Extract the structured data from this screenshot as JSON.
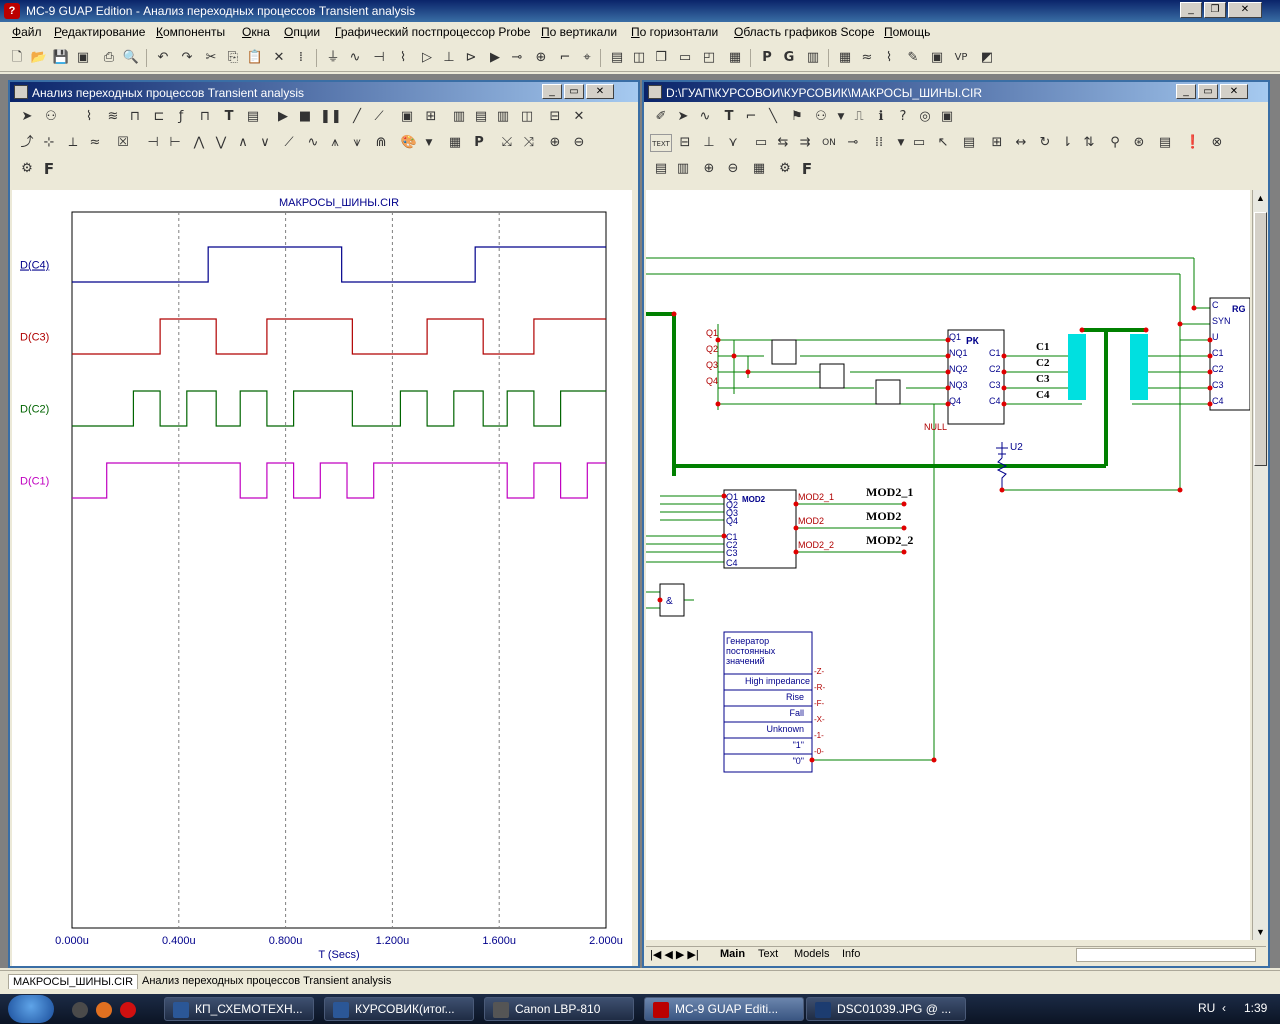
{
  "app": {
    "title": "MC-9 GUAP Edition - Анализ переходных процессов Transient analysis",
    "icon": "mc9-app-icon"
  },
  "menu": [
    "Файл",
    "Редактирование",
    "Компоненты",
    "Окна",
    "Опции",
    "Графический постпроцессор Probe",
    "По вертикали",
    "По горизонтали",
    "Область графиков Scope",
    "Помощь"
  ],
  "plot_window": {
    "title": "Анализ переходных процессов Transient analysis",
    "toolbar_letter": "F"
  },
  "schematic_window": {
    "title": "D:\\ГУАП\\КУРСОВОИ\\КУРСОВИК\\МАКРОСЫ_ШИНЫ.CIR",
    "toolbar_letter": "F",
    "text_button": "TEXT",
    "tabs": [
      "Main",
      "Text",
      "Models",
      "Info"
    ],
    "blocks": {
      "rk_label": "РК",
      "rg_label": "RG",
      "mod_label": "MOD2",
      "and_label": "&",
      "null_label": "NULL",
      "u2_label": "U2",
      "rk_inputs": [
        "Q1",
        "NQ1",
        "NQ2",
        "NQ3",
        "Q4"
      ],
      "rk_outputs": [
        "C1",
        "C2",
        "C3",
        "C4"
      ],
      "rg_pins": [
        "C",
        "SYN",
        "U",
        "C1",
        "C2",
        "C3",
        "C4"
      ],
      "left_q": [
        "Q1",
        "Q2",
        "Q3",
        "Q4"
      ],
      "bus_labels": [
        "C1",
        "C2",
        "C3",
        "C4"
      ],
      "mod_inputs": [
        "Q1",
        "Q2",
        "Q3",
        "Q4",
        "C1",
        "C2",
        "C3",
        "C4"
      ],
      "mod_outputs": [
        "MOD2_1",
        "MOD2",
        "MOD2_2"
      ],
      "mod_net_labels": [
        "MOD2_1",
        "MOD2",
        "MOD2_2"
      ],
      "gen_title": "Генератор постоянных значений",
      "gen_rows": [
        "High impedance",
        "Rise",
        "Fall",
        "Unknown",
        "\"1\"",
        "\"0\""
      ],
      "gen_pins": [
        "-Z-",
        "-R-",
        "-F-",
        "-X-",
        "-1-",
        "-0-"
      ]
    }
  },
  "chart_data": {
    "type": "line",
    "title": "МАКРОСЫ_ШИНЫ.CIR",
    "xlabel": "T (Secs)",
    "xlim": [
      0,
      2.0
    ],
    "x_ticks": [
      "0.000u",
      "0.400u",
      "0.800u",
      "1.200u",
      "1.600u",
      "2.000u"
    ],
    "grid": true,
    "series": [
      {
        "name": "D(C4)",
        "color": "#00008b",
        "transitions": [
          [
            0,
            0
          ],
          [
            0.51,
            1
          ],
          [
            1.01,
            0
          ],
          [
            1.51,
            1
          ],
          [
            2.0,
            1
          ]
        ]
      },
      {
        "name": "D(C3)",
        "color": "#b00000",
        "transitions": [
          [
            0,
            0
          ],
          [
            0.33,
            1
          ],
          [
            0.54,
            0
          ],
          [
            0.73,
            1
          ],
          [
            1.05,
            0
          ],
          [
            1.33,
            1
          ],
          [
            1.54,
            0
          ],
          [
            1.73,
            1
          ],
          [
            2.0,
            1
          ]
        ]
      },
      {
        "name": "D(C2)",
        "color": "#006400",
        "transitions": [
          [
            0,
            0
          ],
          [
            0.23,
            1
          ],
          [
            0.33,
            0
          ],
          [
            0.43,
            1
          ],
          [
            0.54,
            0
          ],
          [
            0.63,
            1
          ],
          [
            0.73,
            0
          ],
          [
            0.83,
            1
          ],
          [
            1.05,
            0
          ],
          [
            1.23,
            1
          ],
          [
            1.33,
            0
          ],
          [
            1.43,
            1
          ],
          [
            1.54,
            0
          ],
          [
            1.63,
            1
          ],
          [
            1.73,
            0
          ],
          [
            1.83,
            1
          ],
          [
            2.0,
            1
          ]
        ]
      },
      {
        "name": "D(C1)",
        "color": "#c000c0",
        "transitions": [
          [
            0,
            0
          ],
          [
            0.13,
            1
          ],
          [
            0.63,
            0
          ],
          [
            0.73,
            1
          ],
          [
            0.83,
            0
          ],
          [
            0.93,
            1
          ],
          [
            1.03,
            0
          ],
          [
            1.13,
            1
          ],
          [
            1.63,
            0
          ],
          [
            1.73,
            1
          ],
          [
            1.83,
            0
          ],
          [
            1.93,
            1
          ],
          [
            2.0,
            1
          ]
        ]
      }
    ]
  },
  "bottom_tabs": [
    "МАКРОСЫ_ШИНЫ.CIR",
    "Анализ переходных процессов Transient analysis"
  ],
  "taskbar": {
    "items": [
      {
        "label": "КП_СХЕМОТЕХН...",
        "icon": "word-icon"
      },
      {
        "label": "КУРСОВИК(итог...",
        "icon": "word-icon"
      },
      {
        "label": "Canon LBP-810",
        "icon": "printer-icon"
      },
      {
        "label": "MC-9 GUAP Editi...",
        "icon": "mc9-icon"
      },
      {
        "label": "DSC01039.JPG @ ...",
        "icon": "photoshop-icon"
      }
    ],
    "lang": "RU",
    "time": "1:39"
  }
}
